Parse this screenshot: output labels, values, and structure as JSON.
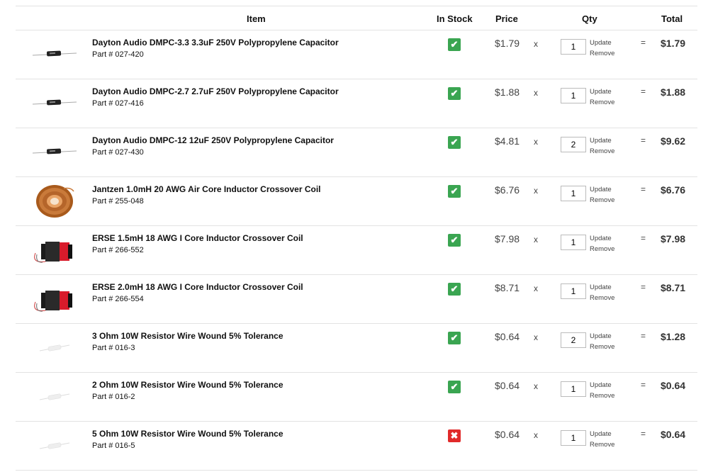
{
  "headers": {
    "item": "Item",
    "in_stock": "In Stock",
    "price": "Price",
    "qty": "Qty",
    "total": "Total"
  },
  "labels": {
    "times": "x",
    "equals": "=",
    "update": "Update",
    "remove": "Remove"
  },
  "icons": {
    "in_stock": "check-icon",
    "out_of_stock": "x-icon"
  },
  "colors": {
    "in_stock": "#3aa551",
    "out_of_stock": "#e12a2a"
  },
  "items": [
    {
      "name": "Dayton Audio DMPC-3.3 3.3uF 250V Polypropylene Capacitor",
      "part": "Part # 027-420",
      "thumb": "capacitor",
      "in_stock": true,
      "price": "$1.79",
      "qty": "1",
      "total": "$1.79"
    },
    {
      "name": "Dayton Audio DMPC-2.7 2.7uF 250V Polypropylene Capacitor",
      "part": "Part # 027-416",
      "thumb": "capacitor",
      "in_stock": true,
      "price": "$1.88",
      "qty": "1",
      "total": "$1.88"
    },
    {
      "name": "Dayton Audio DMPC-12 12uF 250V Polypropylene Capacitor",
      "part": "Part # 027-430",
      "thumb": "capacitor",
      "in_stock": true,
      "price": "$4.81",
      "qty": "2",
      "total": "$9.62"
    },
    {
      "name": "Jantzen 1.0mH 20 AWG Air Core Inductor Crossover Coil",
      "part": "Part # 255-048",
      "thumb": "air-coil",
      "in_stock": true,
      "price": "$6.76",
      "qty": "1",
      "total": "$6.76"
    },
    {
      "name": "ERSE 1.5mH 18 AWG I Core Inductor Crossover Coil",
      "part": "Part # 266-552",
      "thumb": "i-core",
      "in_stock": true,
      "price": "$7.98",
      "qty": "1",
      "total": "$7.98"
    },
    {
      "name": "ERSE 2.0mH 18 AWG I Core Inductor Crossover Coil",
      "part": "Part # 266-554",
      "thumb": "i-core",
      "in_stock": true,
      "price": "$8.71",
      "qty": "1",
      "total": "$8.71"
    },
    {
      "name": "3 Ohm 10W Resistor Wire Wound 5% Tolerance",
      "part": "Part # 016-3",
      "thumb": "resistor",
      "in_stock": true,
      "price": "$0.64",
      "qty": "2",
      "total": "$1.28"
    },
    {
      "name": "2 Ohm 10W Resistor Wire Wound 5% Tolerance",
      "part": "Part # 016-2",
      "thumb": "resistor",
      "in_stock": true,
      "price": "$0.64",
      "qty": "1",
      "total": "$0.64"
    },
    {
      "name": "5 Ohm 10W Resistor Wire Wound 5% Tolerance",
      "part": "Part # 016-5",
      "thumb": "resistor",
      "in_stock": false,
      "price": "$0.64",
      "qty": "1",
      "total": "$0.64"
    }
  ]
}
